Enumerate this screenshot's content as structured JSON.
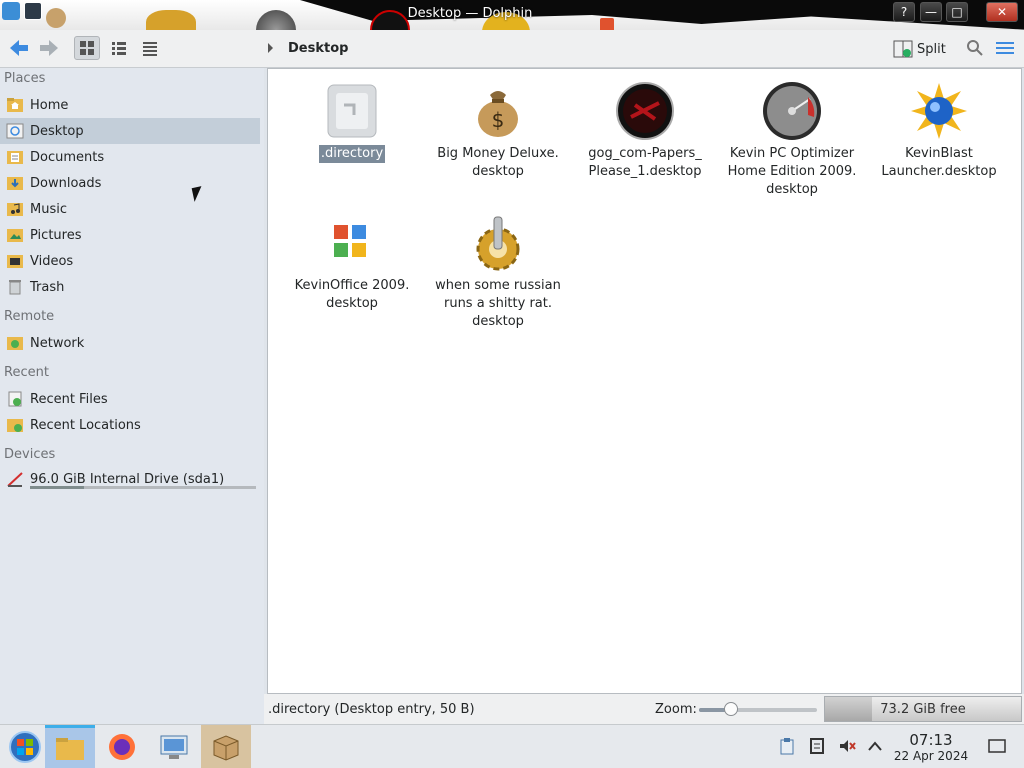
{
  "window": {
    "title": "Desktop — Dolphin"
  },
  "toolbar": {
    "breadcrumb": "Desktop",
    "split_label": "Split"
  },
  "sidebar": {
    "sections": {
      "places": "Places",
      "remote": "Remote",
      "recent": "Recent",
      "devices": "Devices"
    },
    "places": [
      {
        "label": "Home",
        "icon": "home-folder-icon"
      },
      {
        "label": "Desktop",
        "icon": "desktop-folder-icon"
      },
      {
        "label": "Documents",
        "icon": "documents-folder-icon"
      },
      {
        "label": "Downloads",
        "icon": "downloads-folder-icon"
      },
      {
        "label": "Music",
        "icon": "music-folder-icon"
      },
      {
        "label": "Pictures",
        "icon": "pictures-folder-icon"
      },
      {
        "label": "Videos",
        "icon": "videos-folder-icon"
      },
      {
        "label": "Trash",
        "icon": "trash-icon"
      }
    ],
    "remote": [
      {
        "label": "Network",
        "icon": "network-folder-icon"
      }
    ],
    "recent": [
      {
        "label": "Recent Files",
        "icon": "recent-files-icon"
      },
      {
        "label": "Recent Locations",
        "icon": "recent-locations-icon"
      }
    ],
    "devices": [
      {
        "label": "96.0 GiB Internal Drive (sda1)",
        "icon": "drive-icon",
        "usage_fraction": 0.24
      }
    ]
  },
  "files": [
    {
      "name": ".directory",
      "icon": "config-file-icon"
    },
    {
      "name": "Big Money Deluxe.\ndesktop",
      "icon": "money-bag-icon"
    },
    {
      "name": "gog_com-Papers_\nPlease_1.desktop",
      "icon": "papers-please-icon"
    },
    {
      "name": "Kevin PC Optimizer\nHome Edition 2009.\ndesktop",
      "icon": "gauge-icon"
    },
    {
      "name": "KevinBlast\nLauncher.desktop",
      "icon": "blast-globe-icon"
    },
    {
      "name": "KevinOffice 2009.\ndesktop",
      "icon": "office-icon"
    },
    {
      "name": "when some russian\nruns a shitty rat.\ndesktop",
      "icon": "gear-icon"
    }
  ],
  "status": {
    "selection_info": ".directory (Desktop entry, 50 B)",
    "zoom_label": "Zoom:",
    "zoom_fraction": 0.27,
    "free_space": "73.2 GiB free",
    "used_fraction": 0.24
  },
  "taskbar": {
    "time": "07:13",
    "date": "22 Apr 2024"
  },
  "colors": {
    "accent": "#3daee9",
    "selection": "#c3ced9"
  }
}
